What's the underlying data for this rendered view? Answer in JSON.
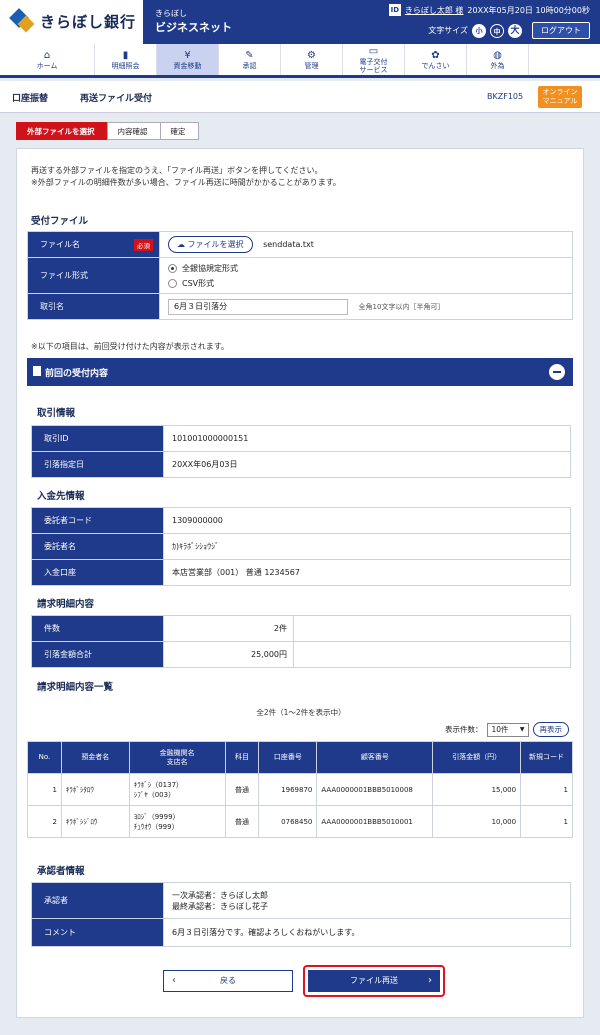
{
  "header": {
    "bank_name": "きらぼし銀行",
    "brand_small": "きらぼし",
    "brand_large": "ビジネスネット",
    "user_icon": "ID",
    "user_name": "きらぼし太郎 様",
    "datetime": "20XX年05月20日 10時00分00秒",
    "font_size_label": "文字サイズ",
    "font_sizes": [
      "小",
      "中",
      "大"
    ],
    "logout": "ログアウト"
  },
  "gnav": [
    {
      "label": "ホーム",
      "icon": "home-icon"
    },
    {
      "label": "明細照会",
      "icon": "document-icon"
    },
    {
      "label": "資金移動",
      "icon": "yen-icon"
    },
    {
      "label": "承認",
      "icon": "approve-icon"
    },
    {
      "label": "管理",
      "icon": "settings-icon"
    },
    {
      "label": "電子交付\nサービス",
      "icon": "monitor-icon"
    },
    {
      "label": "でんさい",
      "icon": "densai-icon"
    },
    {
      "label": "外為",
      "icon": "globe-icon"
    }
  ],
  "page": {
    "category": "口座振替",
    "title": "再送ファイル受付",
    "code": "BKZF105",
    "manual": "オンライン\nマニュアル"
  },
  "steps": [
    "外部ファイルを選択",
    "内容確認",
    "確定"
  ],
  "intro": [
    "再送する外部ファイルを指定のうえ、「ファイル再送」ボタンを押してください。",
    "※外部ファイルの明細件数が多い場合、ファイル再送に時間がかかることがあります。"
  ],
  "receive": {
    "title": "受付ファイル",
    "file_label": "ファイル名",
    "required": "必須",
    "file_button": "ファイルを選択",
    "file_name": "senddata.txt",
    "format_label": "ファイル形式",
    "format_options": [
      "全銀協規定形式",
      "CSV形式"
    ],
    "format_selected": "全銀協規定形式",
    "name_label": "取引名",
    "name_value": "6月３日引落分",
    "name_hint": "全角10文字以内［半角可］"
  },
  "prev_note": "※以下の項目は、前回受け付けた内容が表示されます。",
  "prev_title": "前回の受付内容",
  "trade": {
    "title": "取引情報",
    "rows": [
      {
        "label": "取引ID",
        "value": "101001000000151"
      },
      {
        "label": "引落指定日",
        "value": "20XX年06月03日"
      }
    ]
  },
  "payee": {
    "title": "入金先情報",
    "rows": [
      {
        "label": "委託者コード",
        "value": "1309000000"
      },
      {
        "label": "委託者名",
        "value": "ｶ)ｷﾗﾎﾞｼｼｮｳｼﾞ"
      },
      {
        "label": "入金口座",
        "value": "本店営業部（001） 普通 1234567"
      }
    ]
  },
  "bill": {
    "title": "請求明細内容",
    "rows": [
      {
        "label": "件数",
        "value": "2件"
      },
      {
        "label": "引落金額合計",
        "value": "25,000円"
      }
    ]
  },
  "list": {
    "title": "請求明細内容一覧",
    "count": "全2件（1〜2件を表示中）",
    "per_page_label": "表示件数：",
    "per_page": "10件",
    "redisplay": "再表示",
    "headers": [
      "No.",
      "預金者名",
      "金融機関名\n支店名",
      "科目",
      "口座番号",
      "顧客番号",
      "引落金額（円）",
      "新規コード"
    ],
    "rows": [
      [
        "1",
        "ｷﾗﾎﾞｼﾀﾛｳ",
        "ｷﾗﾎﾞｼ（0137）\nｼﾌﾞﾔ（003）",
        "普通",
        "1969870",
        "AAA0000001BBB5010008",
        "15,000",
        "1"
      ],
      [
        "2",
        "ｷﾗﾎﾞｼｼﾞﾛｳ",
        "ﾖﾛｼﾞ（9999）\nﾁｭｳｵｳ（999）",
        "普通",
        "0768450",
        "AAA0000001BBB5010001",
        "10,000",
        "1"
      ]
    ]
  },
  "approver": {
    "title": "承認者情報",
    "approver_label": "承認者",
    "approver_lines": [
      "一次承認者：きらぼし太郎",
      "最終承認者：きらぼし花子"
    ],
    "comment_label": "コメント",
    "comment": "6月３日引落分です。確認よろしくおねがいします。"
  },
  "buttons": {
    "back": "戻る",
    "send": "ファイル再送"
  },
  "colors": {
    "primary": "#1f3a8a",
    "accent": "#d0121b",
    "manual": "#f19020"
  }
}
